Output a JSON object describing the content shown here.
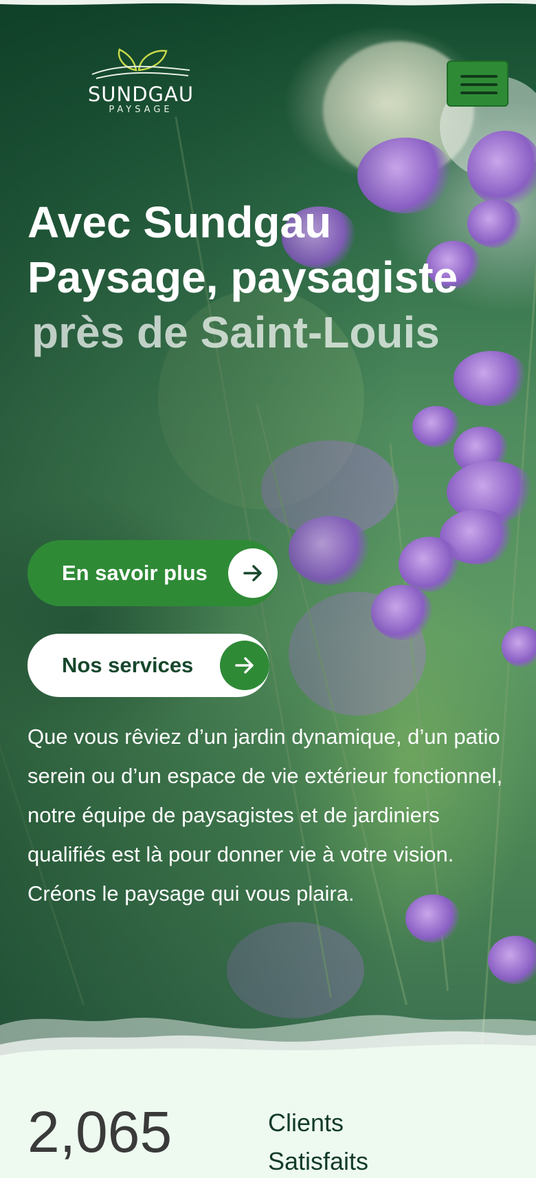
{
  "colors": {
    "brand_green": "#2f8a36",
    "dark_green": "#17472c",
    "stats_bg": "#eefaf0"
  },
  "header": {
    "logo": {
      "name": "SUNDGAU",
      "sub": "PAYSAGE"
    },
    "menu_icon": "hamburger-icon"
  },
  "hero": {
    "title_line1": "Avec Sundgau",
    "title_line2": "Paysage, paysagiste",
    "title_line3": "près de Saint-Louis",
    "cta_primary": {
      "label": "En savoir plus",
      "icon": "arrow-right-icon"
    },
    "cta_secondary": {
      "label": "Nos services",
      "icon": "arrow-right-icon"
    },
    "description": "Que vous rêviez d’un jardin dynamique, d’un patio serein ou d’un espace de vie extérieur fonctionnel, notre équipe de paysagistes et de jardiniers qualifiés est là pour donner vie à votre vision. Créons le paysage qui vous plaira."
  },
  "stats": {
    "value": "2,065",
    "label_line1": "Clients",
    "label_line2": "Satisfaits"
  }
}
